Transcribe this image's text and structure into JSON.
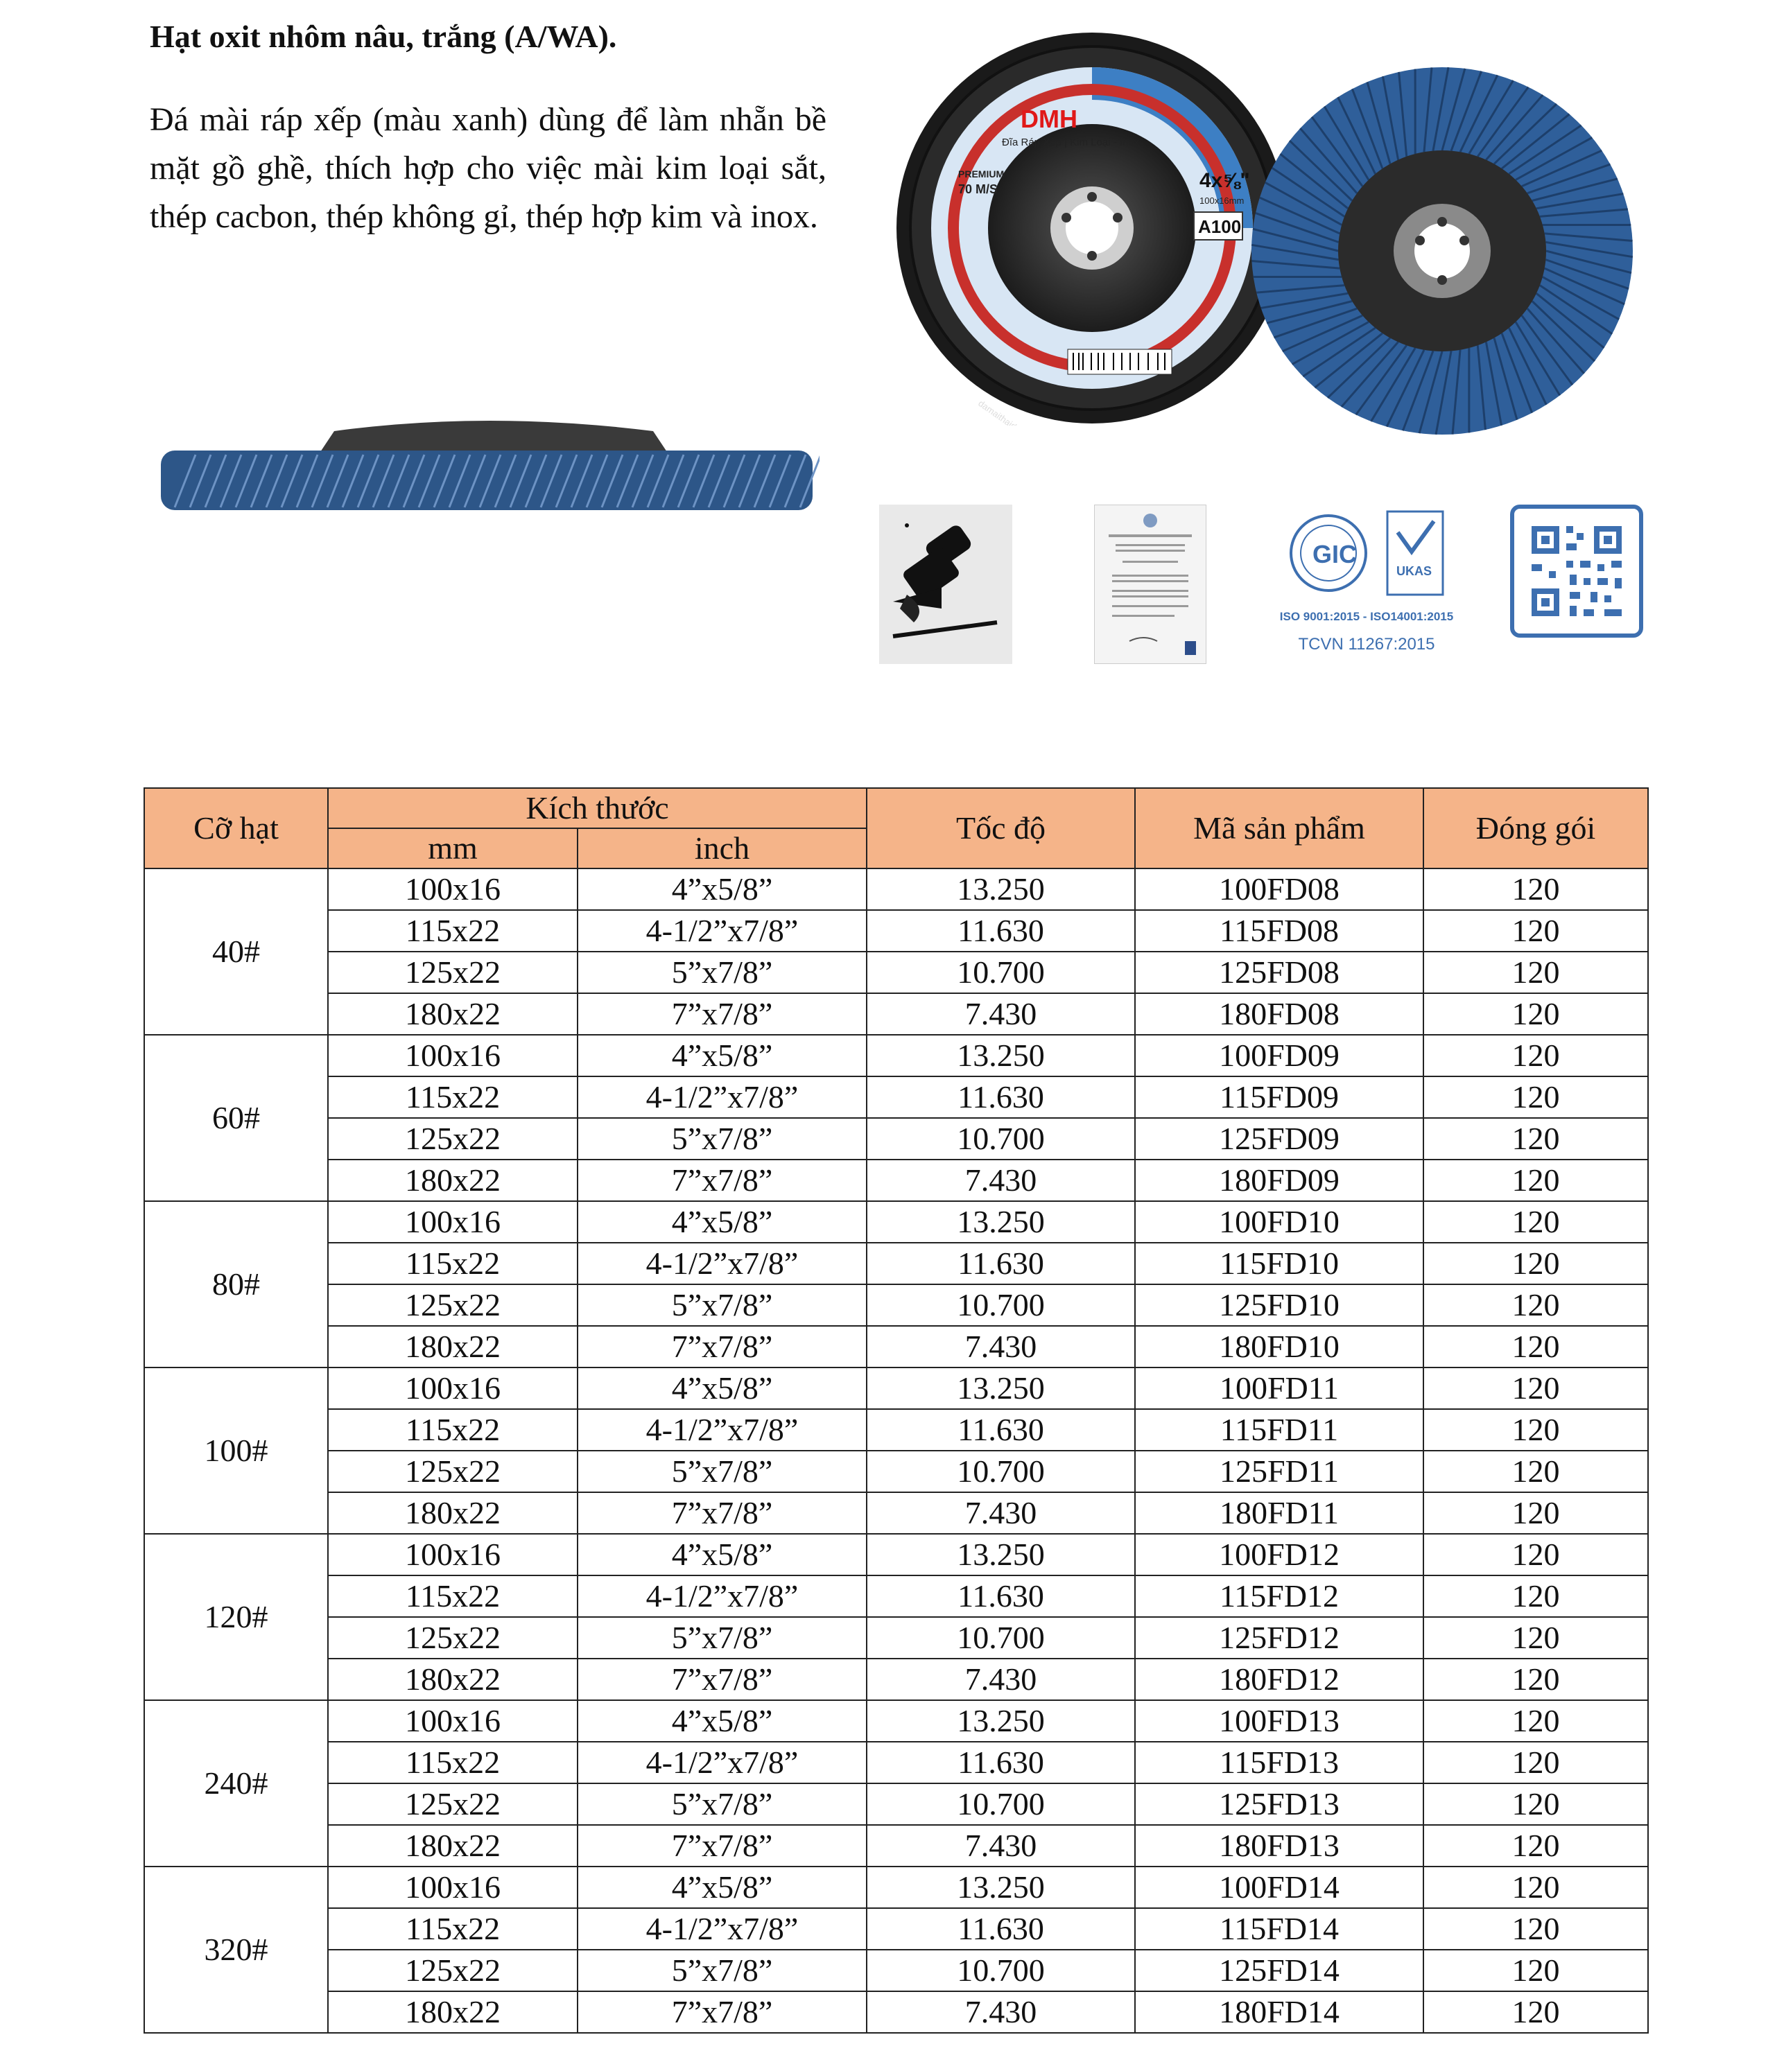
{
  "heading": "Hạt oxit nhôm nâu, trắng (A/WA).",
  "description": "Đá mài ráp xếp (màu xanh) dùng để làm nhẵn bề mặt gồ ghề, thích hợp cho việc mài kim loại sắt, thép cacbon, thép không gỉ, thép hợp kim và inox.",
  "product_label": {
    "brand": "DMH",
    "subtitle": "Đĩa Ráp Xếp | Kim Loại - Inox",
    "premium": "PREMIUM",
    "speed": "70 M/S",
    "size": "4x⅝\"",
    "dim": "100x16mm",
    "grit": "A100",
    "website": "damaithaiduong.vn"
  },
  "certifications": {
    "gic": "GIC",
    "ukas": "UKAS",
    "iso": "ISO 9001:2015 - ISO14001:2015",
    "tcvn": "TCVN 11267:2015"
  },
  "table": {
    "headers": {
      "grit": "Cỡ hạt",
      "dimension": "Kích thước",
      "mm": "mm",
      "inch": "inch",
      "speed": "Tốc độ",
      "code": "Mã sản phẩm",
      "pack": "Đóng gói"
    },
    "groups": [
      {
        "grit": "40#",
        "rows": [
          {
            "mm": "100x16",
            "inch": "4”x5/8”",
            "speed": "13.250",
            "code": "100FD08",
            "pack": "120"
          },
          {
            "mm": "115x22",
            "inch": "4-1/2”x7/8”",
            "speed": "11.630",
            "code": "115FD08",
            "pack": "120"
          },
          {
            "mm": "125x22",
            "inch": "5”x7/8”",
            "speed": "10.700",
            "code": "125FD08",
            "pack": "120"
          },
          {
            "mm": "180x22",
            "inch": "7”x7/8”",
            "speed": "7.430",
            "code": "180FD08",
            "pack": "120"
          }
        ]
      },
      {
        "grit": "60#",
        "rows": [
          {
            "mm": "100x16",
            "inch": "4”x5/8”",
            "speed": "13.250",
            "code": "100FD09",
            "pack": "120"
          },
          {
            "mm": "115x22",
            "inch": "4-1/2”x7/8”",
            "speed": "11.630",
            "code": "115FD09",
            "pack": "120"
          },
          {
            "mm": "125x22",
            "inch": "5”x7/8”",
            "speed": "10.700",
            "code": "125FD09",
            "pack": "120"
          },
          {
            "mm": "180x22",
            "inch": "7”x7/8”",
            "speed": "7.430",
            "code": "180FD09",
            "pack": "120"
          }
        ]
      },
      {
        "grit": "80#",
        "rows": [
          {
            "mm": "100x16",
            "inch": "4”x5/8”",
            "speed": "13.250",
            "code": "100FD10",
            "pack": "120"
          },
          {
            "mm": "115x22",
            "inch": "4-1/2”x7/8”",
            "speed": "11.630",
            "code": "115FD10",
            "pack": "120"
          },
          {
            "mm": "125x22",
            "inch": "5”x7/8”",
            "speed": "10.700",
            "code": "125FD10",
            "pack": "120"
          },
          {
            "mm": "180x22",
            "inch": "7”x7/8”",
            "speed": "7.430",
            "code": "180FD10",
            "pack": "120"
          }
        ]
      },
      {
        "grit": "100#",
        "rows": [
          {
            "mm": "100x16",
            "inch": "4”x5/8”",
            "speed": "13.250",
            "code": "100FD11",
            "pack": "120"
          },
          {
            "mm": "115x22",
            "inch": "4-1/2”x7/8”",
            "speed": "11.630",
            "code": "115FD11",
            "pack": "120"
          },
          {
            "mm": "125x22",
            "inch": "5”x7/8”",
            "speed": "10.700",
            "code": "125FD11",
            "pack": "120"
          },
          {
            "mm": "180x22",
            "inch": "7”x7/8”",
            "speed": "7.430",
            "code": "180FD11",
            "pack": "120"
          }
        ]
      },
      {
        "grit": "120#",
        "rows": [
          {
            "mm": "100x16",
            "inch": "4”x5/8”",
            "speed": "13.250",
            "code": "100FD12",
            "pack": "120"
          },
          {
            "mm": "115x22",
            "inch": "4-1/2”x7/8”",
            "speed": "11.630",
            "code": "115FD12",
            "pack": "120"
          },
          {
            "mm": "125x22",
            "inch": "5”x7/8”",
            "speed": "10.700",
            "code": "125FD12",
            "pack": "120"
          },
          {
            "mm": "180x22",
            "inch": "7”x7/8”",
            "speed": "7.430",
            "code": "180FD12",
            "pack": "120"
          }
        ]
      },
      {
        "grit": "240#",
        "rows": [
          {
            "mm": "100x16",
            "inch": "4”x5/8”",
            "speed": "13.250",
            "code": "100FD13",
            "pack": "120"
          },
          {
            "mm": "115x22",
            "inch": "4-1/2”x7/8”",
            "speed": "11.630",
            "code": "115FD13",
            "pack": "120"
          },
          {
            "mm": "125x22",
            "inch": "5”x7/8”",
            "speed": "10.700",
            "code": "125FD13",
            "pack": "120"
          },
          {
            "mm": "180x22",
            "inch": "7”x7/8”",
            "speed": "7.430",
            "code": "180FD13",
            "pack": "120"
          }
        ]
      },
      {
        "grit": "320#",
        "rows": [
          {
            "mm": "100x16",
            "inch": "4”x5/8”",
            "speed": "13.250",
            "code": "100FD14",
            "pack": "120"
          },
          {
            "mm": "115x22",
            "inch": "4-1/2”x7/8”",
            "speed": "11.630",
            "code": "115FD14",
            "pack": "120"
          },
          {
            "mm": "125x22",
            "inch": "5”x7/8”",
            "speed": "10.700",
            "code": "125FD14",
            "pack": "120"
          },
          {
            "mm": "180x22",
            "inch": "7”x7/8”",
            "speed": "7.430",
            "code": "180FD14",
            "pack": "120"
          }
        ]
      }
    ]
  }
}
